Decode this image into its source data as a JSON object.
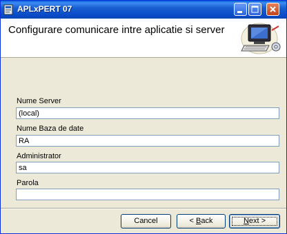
{
  "window": {
    "title": "APLxPERT 07"
  },
  "header": {
    "title": "Configurare comunicare intre aplicatie  si server"
  },
  "fields": [
    {
      "label": "Nume Server",
      "value": "(local)"
    },
    {
      "label": "Nume Baza de date",
      "value": "RA"
    },
    {
      "label": "Administrator",
      "value": "sa"
    },
    {
      "label": "Parola",
      "value": ""
    }
  ],
  "buttons": {
    "cancel": "Cancel",
    "back_prefix": "< ",
    "back_mnemonic": "B",
    "back_rest": "ack",
    "next_mnemonic": "N",
    "next_rest": "ext >"
  },
  "icons": {
    "app": "app-icon",
    "header": "computer-settings-icon",
    "minimize": "minimize-icon",
    "maximize": "maximize-icon",
    "close": "close-icon"
  },
  "colors": {
    "titlebar": "#0a4bc8",
    "dialog_bg": "#ece9d8",
    "close_button": "#c3421a"
  }
}
